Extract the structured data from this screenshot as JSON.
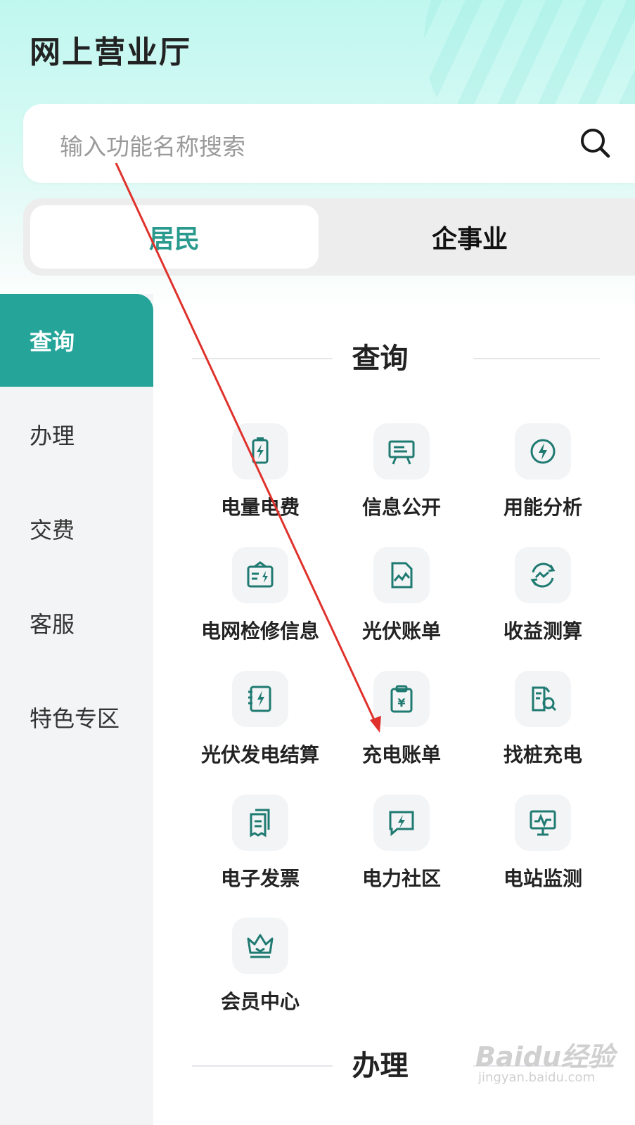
{
  "header": {
    "title": "网上营业厅"
  },
  "search": {
    "placeholder": "输入功能名称搜索",
    "icon": "search-icon"
  },
  "segments": [
    {
      "label": "居民",
      "active": true
    },
    {
      "label": "企事业",
      "active": false
    }
  ],
  "sidebar": {
    "items": [
      {
        "label": "查询",
        "active": true
      },
      {
        "label": "办理",
        "active": false
      },
      {
        "label": "交费",
        "active": false
      },
      {
        "label": "客服",
        "active": false
      },
      {
        "label": "特色专区",
        "active": false
      }
    ]
  },
  "main": {
    "sections": [
      {
        "title": "查询",
        "items": [
          {
            "label": "电量电费",
            "icon": "battery-bolt-icon"
          },
          {
            "label": "信息公开",
            "icon": "billboard-icon"
          },
          {
            "label": "用能分析",
            "icon": "energy-gauge-icon"
          },
          {
            "label": "电网检修信息",
            "icon": "maintenance-board-icon"
          },
          {
            "label": "光伏账单",
            "icon": "pv-chart-icon"
          },
          {
            "label": "收益测算",
            "icon": "profit-cycle-icon"
          },
          {
            "label": "光伏发电结算",
            "icon": "pv-notebook-icon"
          },
          {
            "label": "充电账单",
            "icon": "charge-bill-icon"
          },
          {
            "label": "找桩充电",
            "icon": "find-charger-icon"
          },
          {
            "label": "电子发票",
            "icon": "e-invoice-icon"
          },
          {
            "label": "电力社区",
            "icon": "community-chat-icon"
          },
          {
            "label": "电站监测",
            "icon": "station-monitor-icon"
          },
          {
            "label": "会员中心",
            "icon": "crown-icon"
          }
        ]
      },
      {
        "title": "办理",
        "items": []
      }
    ]
  },
  "watermark": {
    "text": "Baidu经验",
    "url": "jingyan.baidu.com"
  },
  "colors": {
    "accent": "#25a49a",
    "icon": "#1f7a71",
    "annotation": "#e0322c"
  }
}
